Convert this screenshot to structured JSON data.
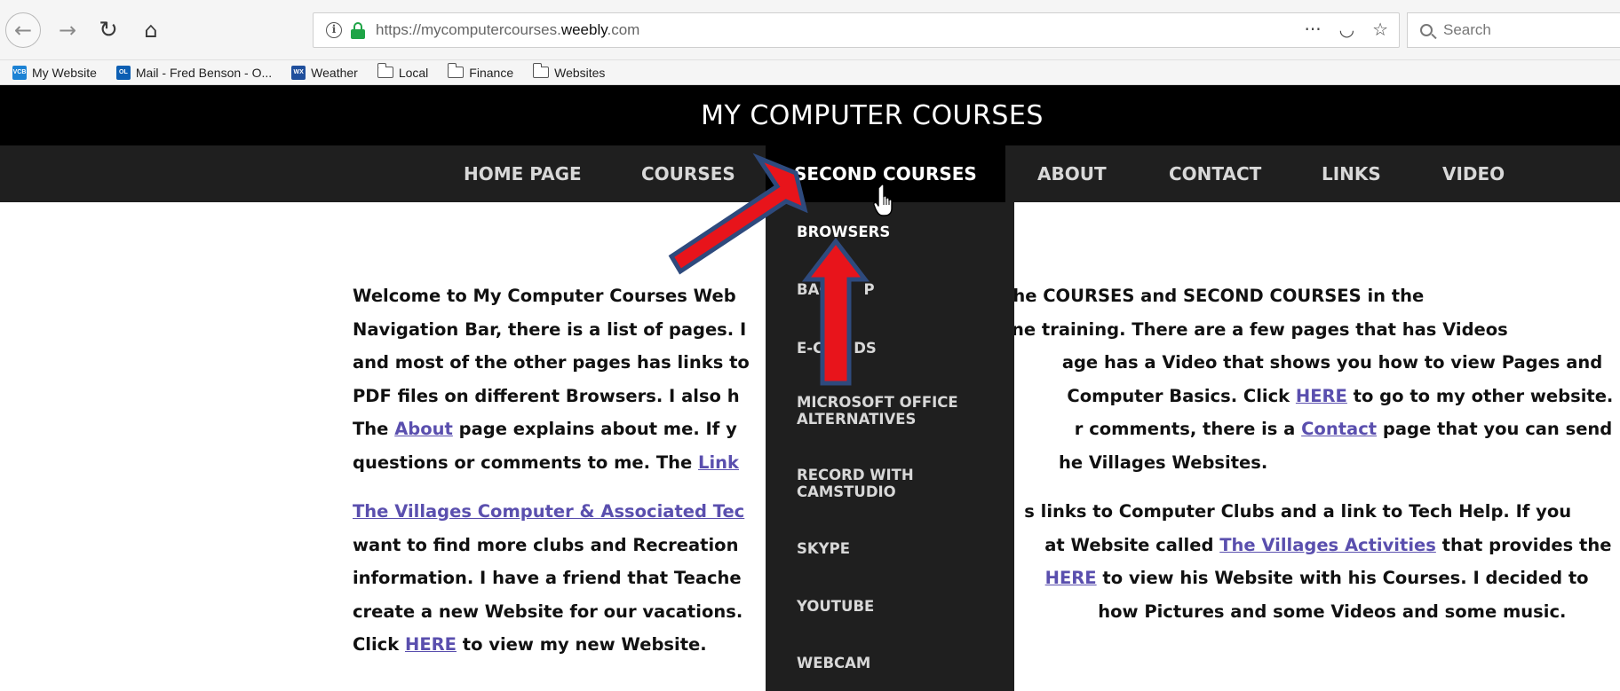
{
  "browser": {
    "url_prefix": "https://mycomputercourses.",
    "url_domain": "weebly",
    "url_suffix": ".com",
    "search_placeholder": "Search",
    "icons": {
      "back": "←",
      "forward": "→",
      "reload": "↻",
      "home": "⌂",
      "menu": "···",
      "pocket": "◡",
      "star": "☆"
    },
    "bookmarks": [
      {
        "label": "My Website",
        "icon": "VCB"
      },
      {
        "label": "Mail - Fred Benson - O...",
        "icon": "OL"
      },
      {
        "label": "Weather",
        "icon": "WX"
      },
      {
        "label": "Local"
      },
      {
        "label": "Finance"
      },
      {
        "label": "Websites"
      }
    ]
  },
  "site": {
    "title": "MY COMPUTER COURSES",
    "nav": [
      "HOME PAGE",
      "COURSES",
      "SECOND COURSES",
      "ABOUT",
      "CONTACT",
      "LINKS",
      "VIDEO"
    ],
    "dropdown": [
      "BROWSERS",
      "BAC",
      "P",
      "E-C",
      "DS",
      "MICROSOFT OFFICE",
      "ALTERNATIVES",
      "RECORD WITH",
      "CAMSTUDIO",
      "SKYPE",
      "YOUTUBE",
      "WEBCAM"
    ]
  },
  "content": {
    "p1": {
      "l1": [
        "Welcome to My Computer Courses Web",
        "ver the COURSES and SECOND COURSES in the"
      ],
      "l2": [
        "Navigation Bar, there is a list of pages.  I",
        "on-line training.  There are a few pages that has Videos"
      ],
      "l3": [
        "and most of the other pages has links to",
        "age has a Video that shows you how to view Pages and"
      ],
      "l4": [
        "PDF files on different Browsers.  I also h",
        " Computer Basics.  Click ",
        "HERE",
        " to go to my other website."
      ],
      "l5": [
        "The ",
        "About",
        " page explains about me.  If y",
        "r comments, there is a ",
        "Contact",
        " page that you can send"
      ],
      "l6": [
        "questions or comments to me.  The ",
        "Link",
        "he Villages Websites."
      ]
    },
    "p2": {
      "l1": [
        "The Villages Computer & Associated Tec",
        "s links to Computer Clubs and a link to Tech Help.  If you"
      ],
      "l2": [
        "want to find more clubs and Recreation ",
        "at Website called ",
        "The Villages Activities",
        " that provides the"
      ],
      "l3": [
        "information.  I have a friend that Teache",
        "HERE",
        " to view his Website with his Courses.  I decided to"
      ],
      "l4": [
        "create a new Website for our vacations.",
        "how Pictures and some Videos and some music."
      ],
      "l5": [
        "Click ",
        "HERE",
        " to view my new Website."
      ]
    }
  },
  "colors": {
    "arrow_fill": "#e8141b",
    "arrow_stroke": "#2e4a7d",
    "link": "#5a4fae",
    "nav_bg": "#1f1f1f",
    "header_bg": "#000000"
  }
}
